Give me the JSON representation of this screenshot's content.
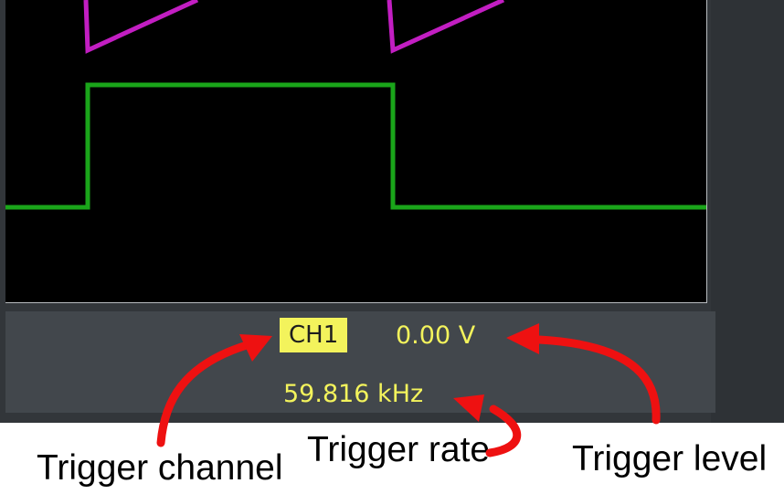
{
  "status": {
    "trigger_channel": "CH1",
    "trigger_level": "0.00 V",
    "trigger_rate": "59.816 kHz"
  },
  "annotations": {
    "trigger_channel_label": "Trigger channel",
    "trigger_rate_label": "Trigger rate",
    "trigger_level_label": "Trigger level"
  },
  "colors": {
    "screen_background": "#000000",
    "ramp_trace": "#c21ec2",
    "square_trace": "#1aa51a",
    "readout_text": "#f3f35c",
    "badge_background": "#f3f35c",
    "arrow": "#ee1111"
  },
  "icons": {
    "arrow": "red-curved-arrow"
  }
}
